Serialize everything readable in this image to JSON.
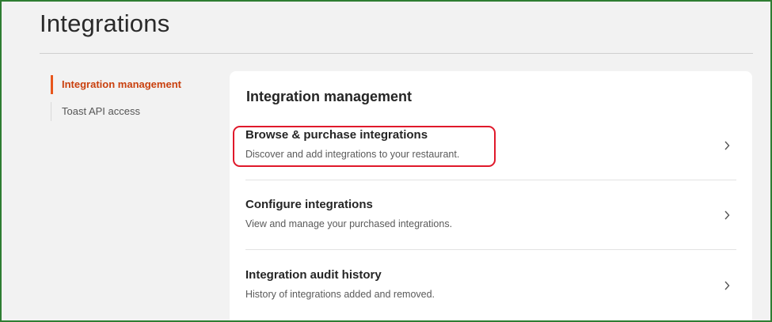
{
  "page": {
    "title": "Integrations"
  },
  "sidenav": {
    "items": [
      {
        "label": "Integration management",
        "active": true
      },
      {
        "label": "Toast API access",
        "active": false
      }
    ]
  },
  "card": {
    "title": "Integration management",
    "rows": [
      {
        "title": "Browse & purchase integrations",
        "description": "Discover and add integrations to your restaurant.",
        "icon": "chevron-right-icon"
      },
      {
        "title": "Configure integrations",
        "description": "View and manage your purchased integrations.",
        "icon": "chevron-right-icon"
      },
      {
        "title": "Integration audit history",
        "description": "History of integrations added and removed.",
        "icon": "chevron-right-icon"
      }
    ]
  },
  "colors": {
    "accent": "#e8561c",
    "active_text": "#c9400e",
    "highlight": "#e0192b",
    "frame": "#2e7d32"
  }
}
